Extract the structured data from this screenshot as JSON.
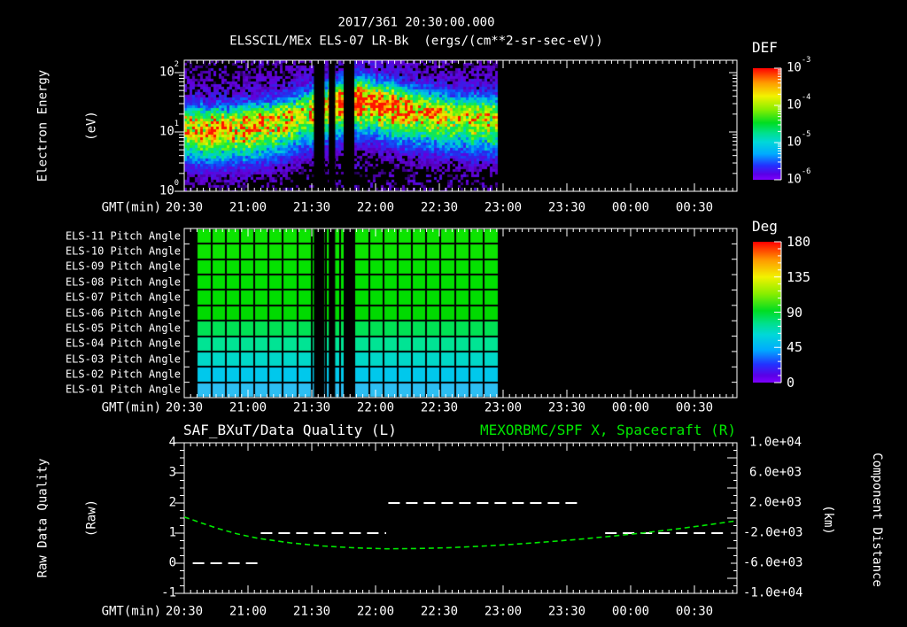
{
  "title": {
    "line1": "2017/361 20:30:00.000",
    "line2": "ELSSCIL/MEx ELS-07 LR-Bk  (ergs/(cm**2-sr-sec-eV))"
  },
  "x_axis": {
    "label": "GMT(min)",
    "tick_labels": [
      "20:30",
      "21:00",
      "21:30",
      "22:00",
      "22:30",
      "23:00",
      "23:30",
      "00:00",
      "00:30"
    ]
  },
  "panel1": {
    "ylabel_line1": "Electron Energy",
    "ylabel_line2": "(eV)",
    "ytick_exponents": [
      "2",
      "1",
      "0"
    ],
    "colorbar": {
      "title": "DEF",
      "tick_exponents": [
        "-3",
        "-4",
        "-5",
        "-6"
      ]
    }
  },
  "panel2": {
    "row_labels": [
      "ELS-11 Pitch Angle",
      "ELS-10 Pitch Angle",
      "ELS-09 Pitch Angle",
      "ELS-08 Pitch Angle",
      "ELS-07 Pitch Angle",
      "ELS-06 Pitch Angle",
      "ELS-05 Pitch Angle",
      "ELS-04 Pitch Angle",
      "ELS-03 Pitch Angle",
      "ELS-02 Pitch Angle",
      "ELS-01 Pitch Angle"
    ],
    "row_colors": [
      "#0ce400",
      "#0ce400",
      "#04e200",
      "#00e000",
      "#00de00",
      "#00da00",
      "#00e254",
      "#00e494",
      "#00d8c8",
      "#00c8ec",
      "#2cbef2"
    ],
    "colorbar": {
      "title": "Deg",
      "tick_labels": [
        "180",
        "135",
        "90",
        "45",
        "0"
      ]
    }
  },
  "panel3": {
    "title_left": "SAF_BXuT/Data Quality (L)",
    "title_right": "MEXORBMC/SPF X, Spacecraft (R)",
    "ylabel_left_line1": "Raw Data Quality",
    "ylabel_left_line2": "(Raw)",
    "ytick_left": [
      "4",
      "3",
      "2",
      "1",
      "0",
      "-1"
    ],
    "ylabel_right_line1": "Component Distance",
    "ylabel_right_line2": "(km)",
    "ytick_right": [
      "1.0e+04",
      "6.0e+03",
      "2.0e+03",
      "-2.0e+03",
      "-6.0e+03",
      "-1.0e+04"
    ]
  },
  "colors": {
    "background": "#000000",
    "text": "#ffffff",
    "accent_green": "#00e800",
    "rainbow_top_to_bottom": [
      "#ff0000",
      "#ff9900",
      "#f2f200",
      "#88ee00",
      "#00dd22",
      "#00e08c",
      "#00d8d8",
      "#00aaff",
      "#2233ff",
      "#5a00e6",
      "#7d00ff"
    ]
  },
  "chart_data": [
    {
      "panel": "electron_energy_spectrogram",
      "type": "heatmap",
      "title": "ELSSCIL/MEx ELS-07 LR-Bk (ergs/(cm**2-sr-sec-eV))",
      "xlabel": "GMT(min)",
      "x_ticks": [
        "20:30",
        "21:00",
        "21:30",
        "22:00",
        "22:30",
        "23:00",
        "23:30",
        "00:00",
        "00:30"
      ],
      "ylabel": "Electron Energy (eV)",
      "y_scale": "log",
      "y_range_eV": [
        1,
        160
      ],
      "colorbar": {
        "title": "DEF",
        "units": "ergs/(cm**2-sr-sec-eV)",
        "scale": "log",
        "range": [
          1e-06,
          0.001
        ]
      },
      "coverage": {
        "data_start_min": 0,
        "data_end_min": 147.5,
        "gaps_min": [
          [
            61,
            66
          ],
          [
            68,
            71
          ],
          [
            75,
            80
          ]
        ],
        "data_start": "20:30",
        "data_end": "~22:58",
        "telemetry_gaps": [
          [
            "~21:31",
            "~21:36"
          ],
          [
            "~21:38",
            "~21:41"
          ],
          [
            "~21:45",
            "~21:50"
          ]
        ]
      },
      "features": "Bright green/yellow electron flux band between ~5 and ~60 eV (DEF ~1e-4 to 1e-3.5), centered near 15 eV at 20:30 rising to ~30-40 eV after 21:45 with yellow hot spots near 21:50-22:00; cyan fringes and sparse blue/purple background counts above and below; black (no data) after ~22:58."
    },
    {
      "panel": "pitch_angle",
      "type": "heatmap",
      "rows_top_to_bottom": [
        "ELS-11",
        "ELS-10",
        "ELS-09",
        "ELS-08",
        "ELS-07",
        "ELS-06",
        "ELS-05",
        "ELS-04",
        "ELS-03",
        "ELS-02",
        "ELS-01"
      ],
      "approx_pitch_angle_deg_per_row": [
        100,
        100,
        99,
        98,
        97,
        95,
        88,
        80,
        70,
        62,
        56
      ],
      "colorbar": {
        "title": "Deg",
        "range": [
          0,
          180
        ],
        "ticks": [
          180,
          135,
          90,
          45,
          0
        ]
      },
      "coverage": {
        "data_start_min": 6,
        "data_end_min": 147.5,
        "gaps_min": [
          [
            61,
            66
          ],
          [
            68,
            71
          ],
          [
            75,
            80
          ]
        ]
      },
      "grid": "time cells ~6.7 min wide separated by black gridlines; rows shade green (top) to sky blue (bottom)"
    },
    {
      "panel": "quality_and_distance",
      "type": "line",
      "xlabel": "GMT(min)",
      "x_ticks": [
        "20:30",
        "21:00",
        "21:30",
        "22:00",
        "22:30",
        "23:00",
        "23:30",
        "00:00",
        "00:30"
      ],
      "ylim_left": [
        -1,
        4
      ],
      "ylim_right": [
        -10000,
        10000
      ],
      "series": [
        {
          "name": "SAF_BXuT/Data Quality (L)",
          "axis": "left",
          "color": "#ffffff",
          "style": "dashed",
          "note": "minutes measured from 20:30",
          "segments": [
            {
              "value": 0,
              "start_min": 4,
              "end_min": 35
            },
            {
              "value": 1,
              "start_min": 36,
              "end_min": 95
            },
            {
              "value": 2,
              "start_min": 96,
              "end_min": 187
            },
            {
              "value": 1,
              "start_min": 198,
              "end_min": 254
            }
          ]
        },
        {
          "name": "MEXORBMC/SPF X, Spacecraft (R)",
          "axis": "right",
          "color": "#00e800",
          "style": "dashed",
          "points_min_km": [
            [
              0,
              150
            ],
            [
              8,
              -650
            ],
            [
              16,
              -1400
            ],
            [
              25,
              -2100
            ],
            [
              35,
              -2700
            ],
            [
              50,
              -3300
            ],
            [
              65,
              -3700
            ],
            [
              80,
              -3950
            ],
            [
              95,
              -4080
            ],
            [
              110,
              -4050
            ],
            [
              125,
              -3930
            ],
            [
              140,
              -3730
            ],
            [
              155,
              -3480
            ],
            [
              170,
              -3180
            ],
            [
              185,
              -2830
            ],
            [
              200,
              -2430
            ],
            [
              215,
              -2000
            ],
            [
              230,
              -1500
            ],
            [
              245,
              -950
            ],
            [
              260,
              -350
            ]
          ]
        }
      ]
    }
  ]
}
